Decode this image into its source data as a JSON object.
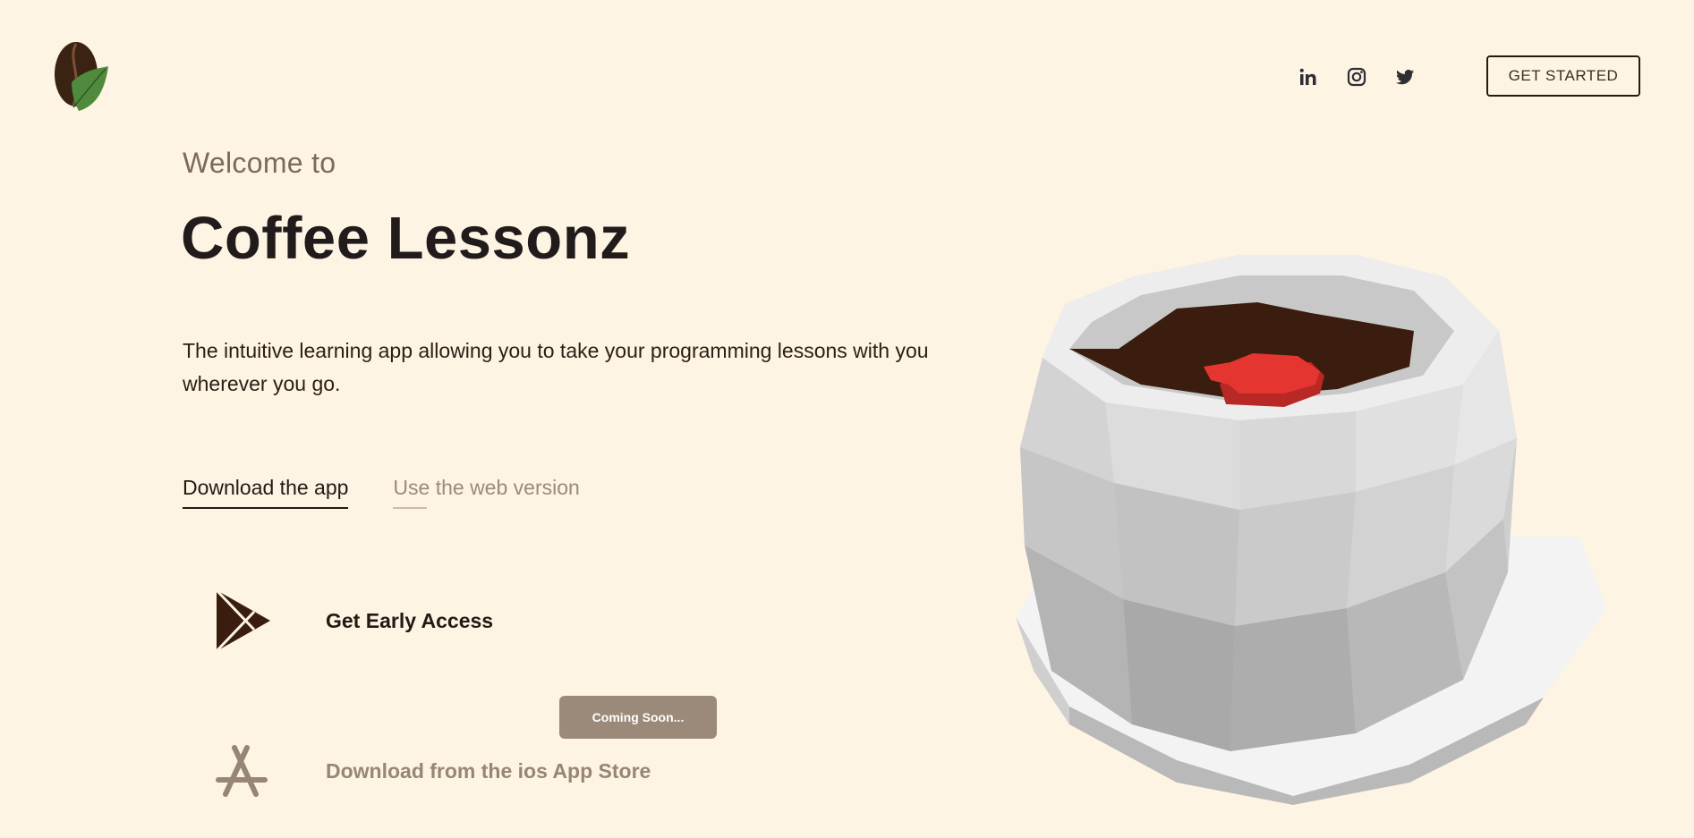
{
  "header": {
    "cta_label": "GET STARTED",
    "socials": [
      {
        "icon": "linkedin-icon"
      },
      {
        "icon": "instagram-icon"
      },
      {
        "icon": "twitter-icon"
      }
    ]
  },
  "hero": {
    "welcome": "Welcome to",
    "title": "Coffee Lessonz",
    "description": "The intuitive learning app allowing you to take your programming lessons with you wherever you go."
  },
  "tabs": [
    {
      "label": "Download the app",
      "active": true
    },
    {
      "label": "Use the web version",
      "active": false
    }
  ],
  "downloads": {
    "play": {
      "icon": "google-play-icon",
      "label": "Get Early Access"
    },
    "ios": {
      "icon": "app-store-icon",
      "label": "Download from the ios App Store",
      "badge": "Coming Soon..."
    }
  },
  "colors": {
    "background": "#fdf4e3",
    "text": "#241a14",
    "muted": "#978675",
    "badge": "#9b8a79",
    "coffee": "#3a1d0e",
    "heart": "#e53530"
  }
}
